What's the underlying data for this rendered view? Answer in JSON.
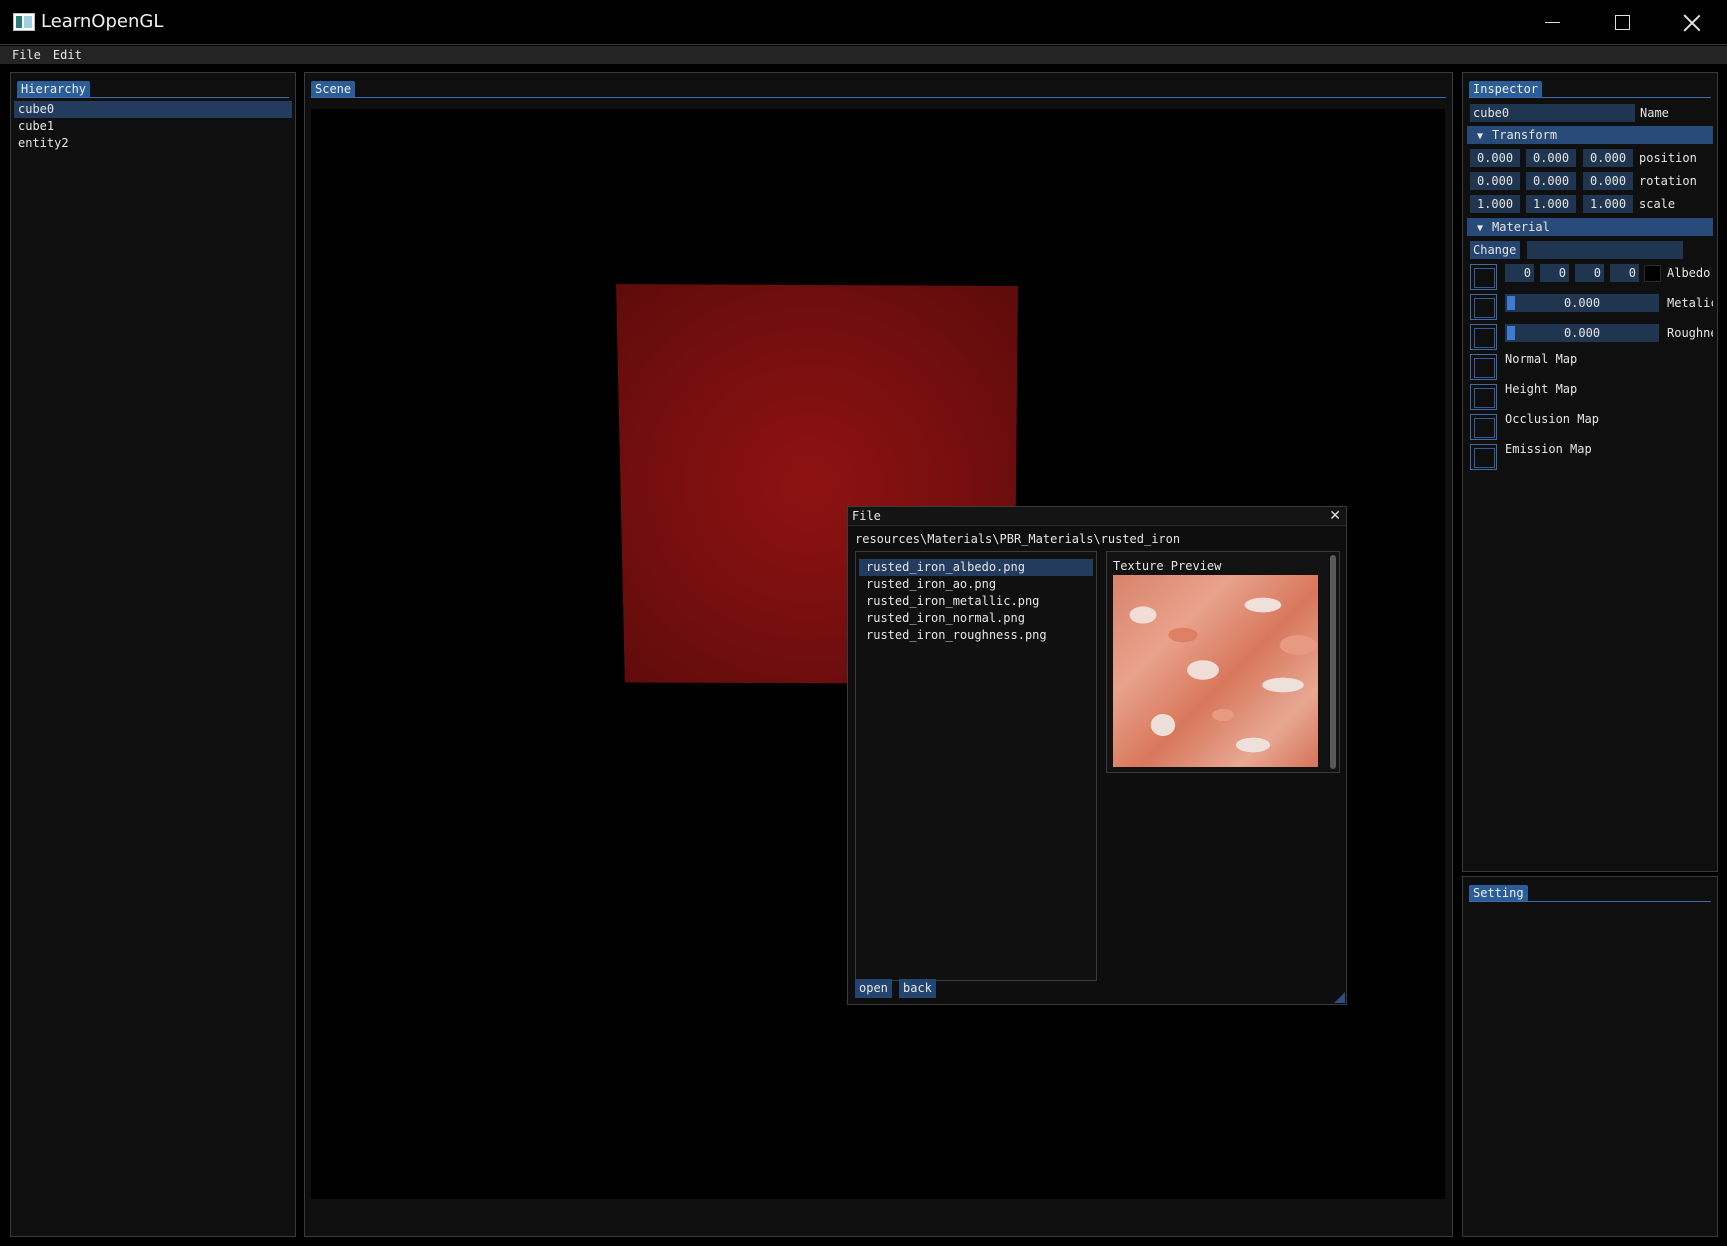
{
  "window": {
    "title": "LearnOpenGL"
  },
  "menu": {
    "file": "File",
    "edit": "Edit"
  },
  "hierarchy": {
    "tab": "Hierarchy",
    "items": [
      "cube0",
      "cube1",
      "entity2"
    ],
    "selected_index": 0
  },
  "scene": {
    "tab": "Scene",
    "cube_color": "#7a0f0f"
  },
  "file_dialog": {
    "title": "File",
    "path": "resources\\Materials\\PBR_Materials\\rusted_iron",
    "files": [
      "rusted_iron_albedo.png",
      "rusted_iron_ao.png",
      "rusted_iron_metallic.png",
      "rusted_iron_normal.png",
      "rusted_iron_roughness.png"
    ],
    "selected_index": 0,
    "preview_label": "Texture Preview",
    "open_label": "open",
    "back_label": "back",
    "close_icon": "close-icon"
  },
  "inspector": {
    "tab": "Inspector",
    "name_value": "cube0",
    "name_label": "Name",
    "transform_header": "Transform",
    "position": {
      "x": "0.000",
      "y": "0.000",
      "z": "0.000",
      "label": "position"
    },
    "rotation": {
      "x": "0.000",
      "y": "0.000",
      "z": "0.000",
      "label": "rotation"
    },
    "scale": {
      "x": "1.000",
      "y": "1.000",
      "z": "1.000",
      "label": "scale"
    },
    "material_header": "Material",
    "change_label": "Change",
    "change_value": "",
    "albedo": {
      "r": "0",
      "g": "0",
      "b": "0",
      "a": "0",
      "label": "Albedo",
      "swatch_color": "#000000"
    },
    "metallic": {
      "value": "0.000",
      "label": "Metalic"
    },
    "roughness": {
      "value": "0.000",
      "label": "Roughness"
    },
    "maps": [
      "Normal Map",
      "Height Map",
      "Occlusion Map",
      "Emission Map"
    ]
  },
  "setting": {
    "tab": "Setting"
  }
}
